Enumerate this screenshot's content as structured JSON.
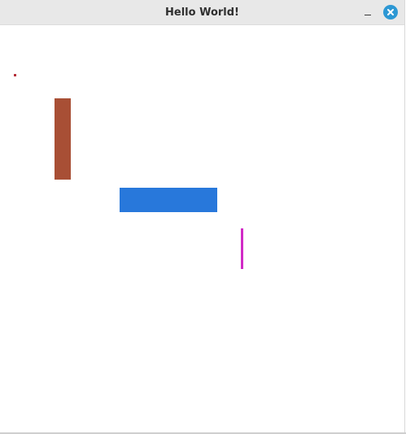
{
  "window": {
    "title": "Hello World!",
    "controls": {
      "minimize_icon": "minimize-icon",
      "close_icon": "close-icon",
      "close_color": "#2d98d4"
    }
  },
  "canvas": {
    "background": "#ffffff",
    "shapes": [
      {
        "name": "small-dot",
        "color": "#b5303a"
      },
      {
        "name": "tall-rectangle",
        "color": "#a84f35"
      },
      {
        "name": "wide-rectangle",
        "color": "#2878db"
      },
      {
        "name": "vertical-line",
        "color": "#d12ac6"
      }
    ]
  }
}
